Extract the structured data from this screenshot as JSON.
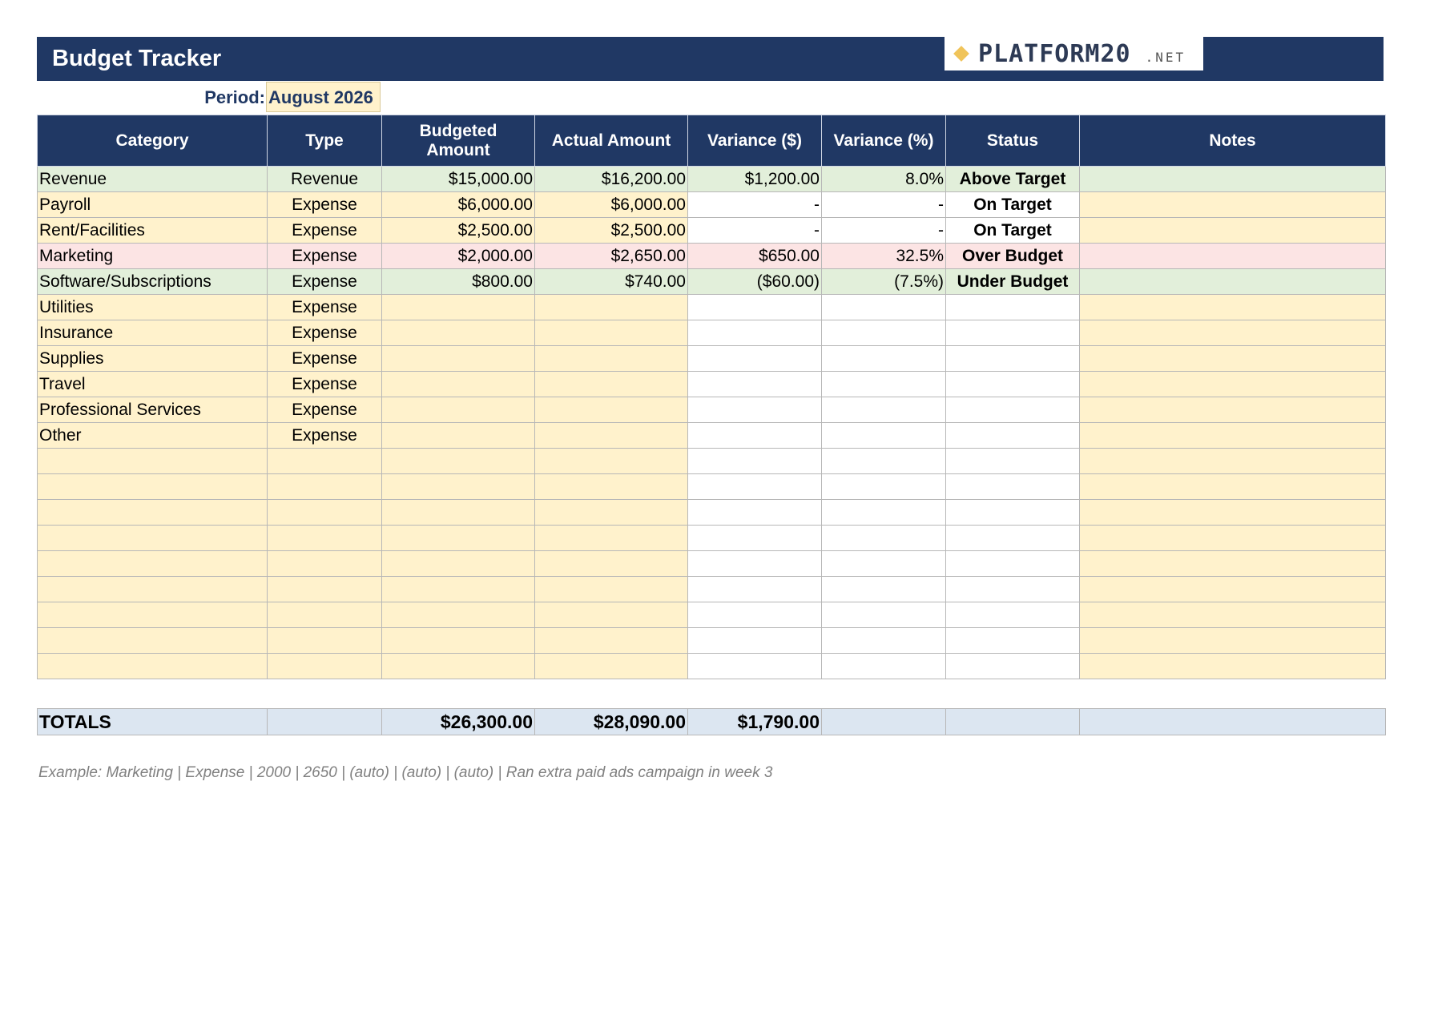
{
  "header": {
    "title": "Budget Tracker",
    "logo_main": "PLATFORM20",
    "logo_sub": ".NET",
    "logo_icon": "diamond-icon",
    "period_label": "Period:",
    "period_value": "August 2026"
  },
  "colors": {
    "header_bg": "#203864",
    "input_bg": "#fff2cc",
    "positive_row": "#e2efda",
    "negative_row": "#fce4e4",
    "totals_bg": "#dce6f1",
    "logo_accent": "#f0c45a"
  },
  "table": {
    "columns": [
      "Category",
      "Type",
      "Budgeted Amount",
      "Actual Amount",
      "Variance ($)",
      "Variance (%)",
      "Status",
      "Notes"
    ],
    "rows": [
      {
        "category": "Revenue",
        "type": "Revenue",
        "budgeted": "$15,000.00",
        "actual": "$16,200.00",
        "var_amt": "$1,200.00",
        "var_pct": "8.0%",
        "status": "Above Target",
        "notes": "",
        "highlight": "green"
      },
      {
        "category": "Payroll",
        "type": "Expense",
        "budgeted": "$6,000.00",
        "actual": "$6,000.00",
        "var_amt": "-",
        "var_pct": "-",
        "status": "On Target",
        "notes": "",
        "highlight": ""
      },
      {
        "category": "Rent/Facilities",
        "type": "Expense",
        "budgeted": "$2,500.00",
        "actual": "$2,500.00",
        "var_amt": "-",
        "var_pct": "-",
        "status": "On Target",
        "notes": "",
        "highlight": ""
      },
      {
        "category": "Marketing",
        "type": "Expense",
        "budgeted": "$2,000.00",
        "actual": "$2,650.00",
        "var_amt": "$650.00",
        "var_pct": "32.5%",
        "status": "Over Budget",
        "notes": "",
        "highlight": "red"
      },
      {
        "category": "Software/Subscriptions",
        "type": "Expense",
        "budgeted": "$800.00",
        "actual": "$740.00",
        "var_amt": "($60.00)",
        "var_pct": "(7.5%)",
        "status": "Under Budget",
        "notes": "",
        "highlight": "green"
      },
      {
        "category": "Utilities",
        "type": "Expense",
        "budgeted": "",
        "actual": "",
        "var_amt": "",
        "var_pct": "",
        "status": "",
        "notes": "",
        "highlight": ""
      },
      {
        "category": "Insurance",
        "type": "Expense",
        "budgeted": "",
        "actual": "",
        "var_amt": "",
        "var_pct": "",
        "status": "",
        "notes": "",
        "highlight": ""
      },
      {
        "category": "Supplies",
        "type": "Expense",
        "budgeted": "",
        "actual": "",
        "var_amt": "",
        "var_pct": "",
        "status": "",
        "notes": "",
        "highlight": ""
      },
      {
        "category": "Travel",
        "type": "Expense",
        "budgeted": "",
        "actual": "",
        "var_amt": "",
        "var_pct": "",
        "status": "",
        "notes": "",
        "highlight": ""
      },
      {
        "category": "Professional Services",
        "type": "Expense",
        "budgeted": "",
        "actual": "",
        "var_amt": "",
        "var_pct": "",
        "status": "",
        "notes": "",
        "highlight": ""
      },
      {
        "category": "Other",
        "type": "Expense",
        "budgeted": "",
        "actual": "",
        "var_amt": "",
        "var_pct": "",
        "status": "",
        "notes": "",
        "highlight": ""
      },
      {
        "category": "",
        "type": "",
        "budgeted": "",
        "actual": "",
        "var_amt": "",
        "var_pct": "",
        "status": "",
        "notes": "",
        "highlight": ""
      },
      {
        "category": "",
        "type": "",
        "budgeted": "",
        "actual": "",
        "var_amt": "",
        "var_pct": "",
        "status": "",
        "notes": "",
        "highlight": ""
      },
      {
        "category": "",
        "type": "",
        "budgeted": "",
        "actual": "",
        "var_amt": "",
        "var_pct": "",
        "status": "",
        "notes": "",
        "highlight": ""
      },
      {
        "category": "",
        "type": "",
        "budgeted": "",
        "actual": "",
        "var_amt": "",
        "var_pct": "",
        "status": "",
        "notes": "",
        "highlight": ""
      },
      {
        "category": "",
        "type": "",
        "budgeted": "",
        "actual": "",
        "var_amt": "",
        "var_pct": "",
        "status": "",
        "notes": "",
        "highlight": ""
      },
      {
        "category": "",
        "type": "",
        "budgeted": "",
        "actual": "",
        "var_amt": "",
        "var_pct": "",
        "status": "",
        "notes": "",
        "highlight": ""
      },
      {
        "category": "",
        "type": "",
        "budgeted": "",
        "actual": "",
        "var_amt": "",
        "var_pct": "",
        "status": "",
        "notes": "",
        "highlight": ""
      },
      {
        "category": "",
        "type": "",
        "budgeted": "",
        "actual": "",
        "var_amt": "",
        "var_pct": "",
        "status": "",
        "notes": "",
        "highlight": ""
      },
      {
        "category": "",
        "type": "",
        "budgeted": "",
        "actual": "",
        "var_amt": "",
        "var_pct": "",
        "status": "",
        "notes": "",
        "highlight": ""
      }
    ]
  },
  "totals": {
    "label": "TOTALS",
    "budgeted": "$26,300.00",
    "actual": "$28,090.00",
    "var_amt": "$1,790.00"
  },
  "example_note": "Example: Marketing | Expense | 2000 | 2650 | (auto) | (auto) | (auto) | Ran extra paid ads campaign in week 3"
}
